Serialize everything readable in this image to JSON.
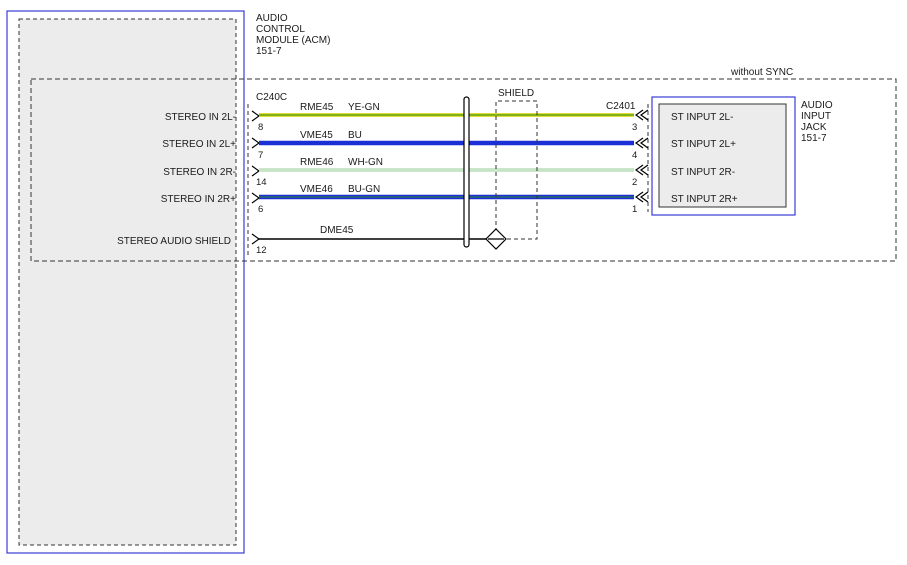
{
  "acm": {
    "title_lines": [
      "AUDIO",
      "CONTROL",
      "MODULE (ACM)",
      "151-7"
    ],
    "connector": "C240C",
    "pins": [
      {
        "label": "STEREO IN 2L-",
        "pin": "8"
      },
      {
        "label": "STEREO IN 2L+",
        "pin": "7"
      },
      {
        "label": "STEREO IN 2R-",
        "pin": "14"
      },
      {
        "label": "STEREO IN 2R+",
        "pin": "6"
      },
      {
        "label": "STEREO AUDIO SHIELD",
        "pin": "12"
      }
    ]
  },
  "option_label": "without SYNC",
  "shield_label": "SHIELD",
  "wires": [
    {
      "circuit": "RME45",
      "color_code": "YE-GN",
      "colors": [
        "#d4d400",
        "#2e8b2e"
      ]
    },
    {
      "circuit": "VME45",
      "color_code": "BU",
      "colors": [
        "#1a2fd6"
      ]
    },
    {
      "circuit": "RME46",
      "color_code": "WH-GN",
      "colors": [
        "#d8ecd8",
        "#2e8b2e"
      ]
    },
    {
      "circuit": "VME46",
      "color_code": "BU-GN",
      "colors": [
        "#1a2fd6",
        "#2e8b2e"
      ]
    },
    {
      "circuit": "DME45",
      "color_code": "",
      "colors": [
        "#000000"
      ]
    }
  ],
  "jack": {
    "title_lines": [
      "AUDIO",
      "INPUT",
      "JACK",
      "151-7"
    ],
    "connector": "C2401",
    "pins": [
      {
        "label": "ST INPUT 2L-",
        "pin": "3"
      },
      {
        "label": "ST INPUT 2L+",
        "pin": "4"
      },
      {
        "label": "ST INPUT 2R-",
        "pin": "2"
      },
      {
        "label": "ST INPUT 2R+",
        "pin": "1"
      }
    ]
  },
  "colors": {
    "module_border": "#3b3bd6",
    "dash": "#333333"
  }
}
